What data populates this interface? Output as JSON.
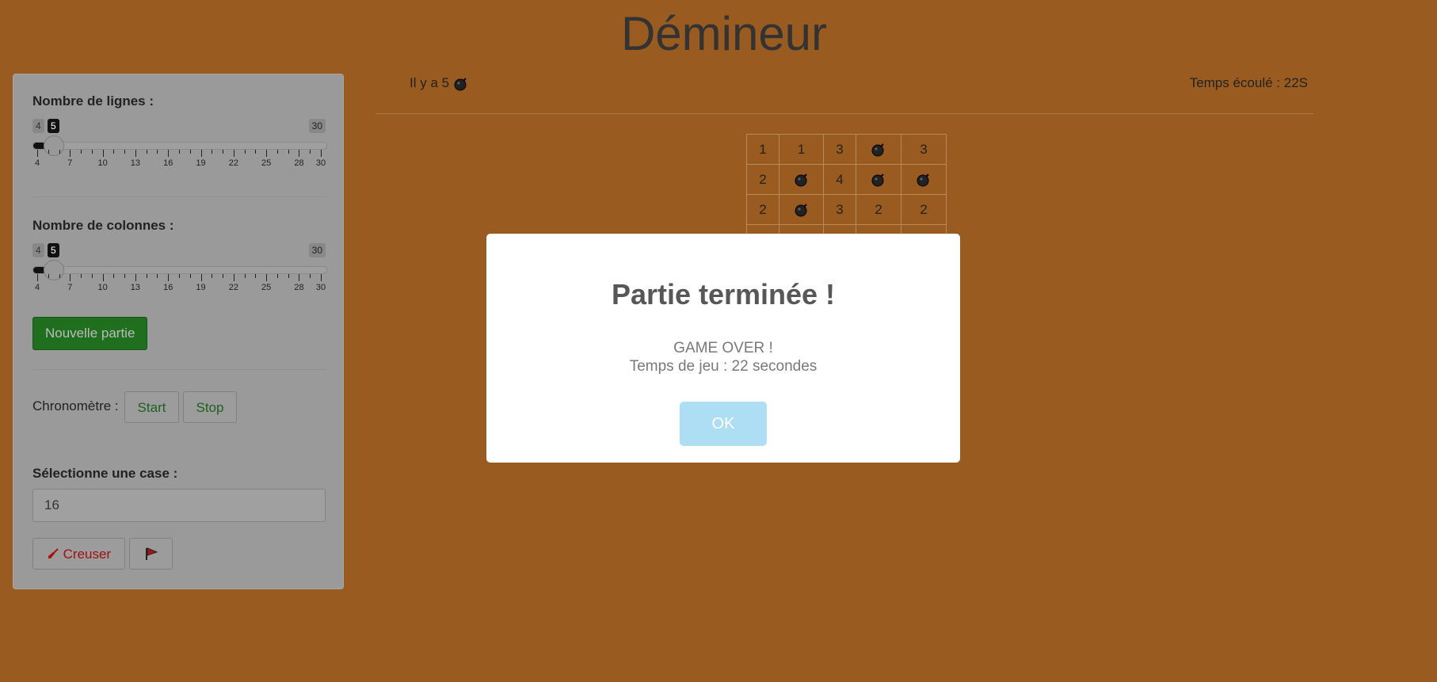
{
  "app": {
    "title": "Démineur"
  },
  "sidebar": {
    "rows": {
      "label": "Nombre de lignes :",
      "min": "4",
      "max": "30",
      "value": "5",
      "fraction": 0.038,
      "ticks": [
        "4",
        "7",
        "10",
        "13",
        "16",
        "19",
        "22",
        "25",
        "28",
        "30"
      ]
    },
    "cols": {
      "label": "Nombre de colonnes :",
      "min": "4",
      "max": "30",
      "value": "5",
      "fraction": 0.038,
      "ticks": [
        "4",
        "7",
        "10",
        "13",
        "16",
        "19",
        "22",
        "25",
        "28",
        "30"
      ]
    },
    "new_game_label": "Nouvelle partie",
    "chrono_label": "Chronomètre :",
    "start_label": "Start",
    "stop_label": "Stop",
    "select_label": "Sélectionne une case :",
    "select_value": "16",
    "dig_label": "Creuser"
  },
  "header": {
    "mines_text": "Il y a 5",
    "elapsed_text": "Temps écoulé : 22S"
  },
  "board": {
    "rows": [
      [
        "1",
        "1",
        "3",
        "bomb",
        "3"
      ],
      [
        "2",
        "bomb",
        "4",
        "bomb",
        "bomb"
      ],
      [
        "2",
        "bomb",
        "3",
        "2",
        "2"
      ]
    ],
    "partial_row_count": 1
  },
  "modal": {
    "title": "Partie terminée !",
    "line1": "GAME OVER !",
    "line2": "Temps de jeu : 22 secondes",
    "ok_label": "OK"
  },
  "colors": {
    "background": "#995b1f",
    "green_button": "#1f6f1f",
    "ok_button": "#aedef4"
  }
}
